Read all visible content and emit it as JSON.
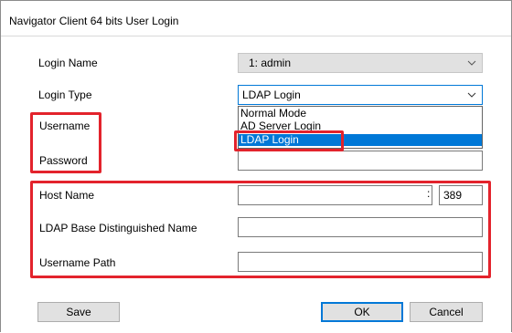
{
  "window": {
    "title": "Navigator Client 64 bits User Login"
  },
  "form": {
    "login_name": {
      "label": "Login Name",
      "value": "1: admin"
    },
    "login_type": {
      "label": "Login Type",
      "value": "LDAP Login",
      "options": [
        "Normal Mode",
        "AD Server Login",
        "LDAP Login"
      ]
    },
    "username": {
      "label": "Username",
      "value": ""
    },
    "password": {
      "label": "Password",
      "value": ""
    },
    "host_name": {
      "label": "Host Name",
      "value": "",
      "port_separator": ":",
      "port": "389"
    },
    "ldap_base_dn": {
      "label": "LDAP Base Distinguished Name",
      "value": ""
    },
    "username_path": {
      "label": "Username Path",
      "value": ""
    }
  },
  "buttons": {
    "save": "Save",
    "ok": "OK",
    "cancel": "Cancel"
  },
  "colors": {
    "highlight": "#e3232c",
    "selection": "#0078d7"
  }
}
